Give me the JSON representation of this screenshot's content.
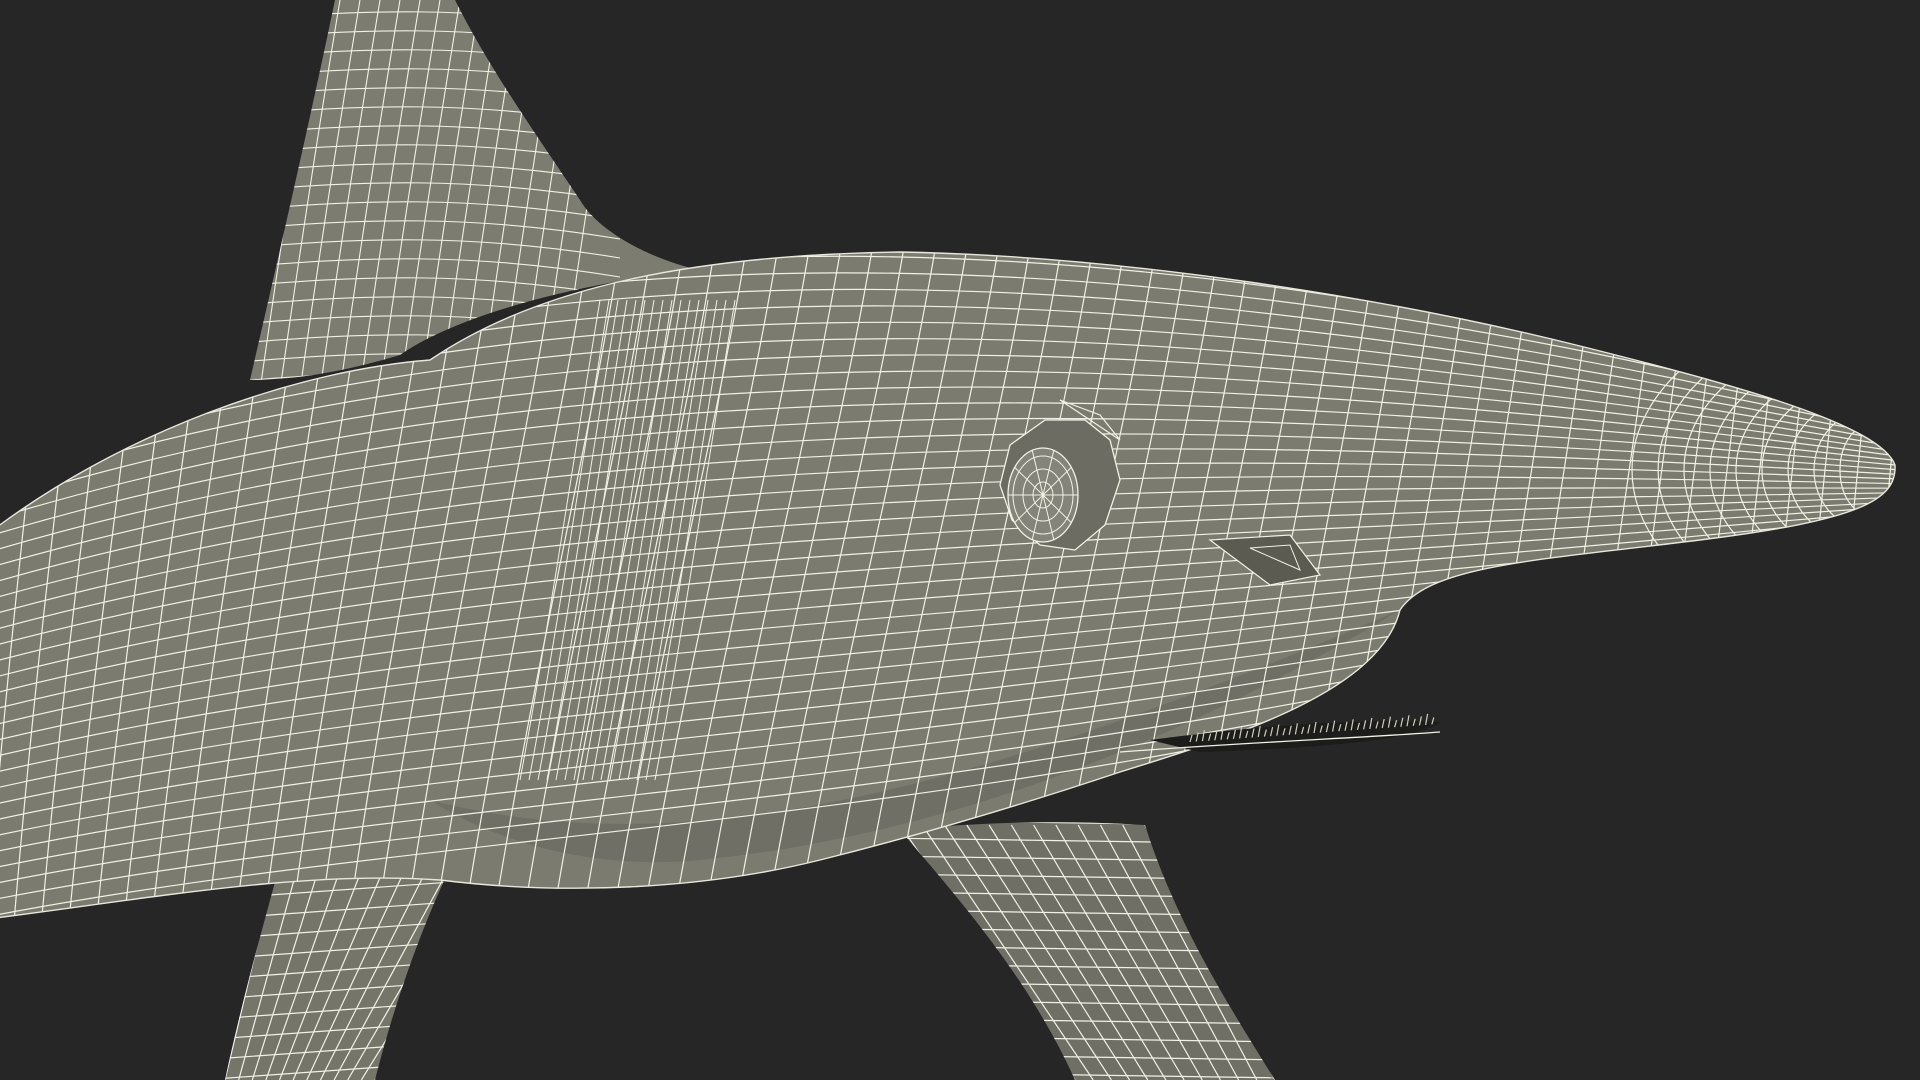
{
  "scene": {
    "subject": "wireframe-shark-model",
    "colors": {
      "background": "#262626",
      "mesh_fill": "#7a7a6f",
      "mesh_shadow": "#55554c",
      "wire": "#f2f1e6",
      "mouth": "#1c1c1a"
    }
  }
}
